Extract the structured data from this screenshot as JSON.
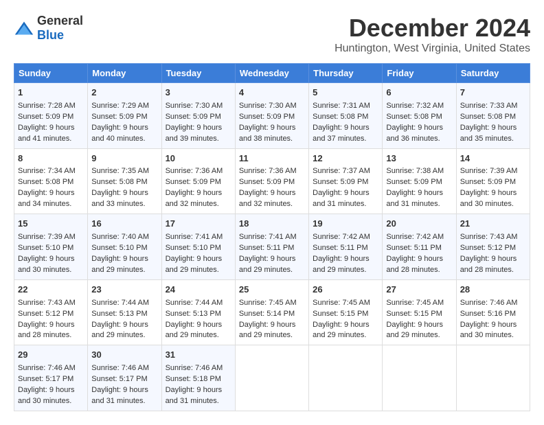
{
  "logo": {
    "general": "General",
    "blue": "Blue"
  },
  "title": "December 2024",
  "subtitle": "Huntington, West Virginia, United States",
  "days_of_week": [
    "Sunday",
    "Monday",
    "Tuesday",
    "Wednesday",
    "Thursday",
    "Friday",
    "Saturday"
  ],
  "weeks": [
    [
      {
        "day": "1",
        "sunrise": "Sunrise: 7:28 AM",
        "sunset": "Sunset: 5:09 PM",
        "daylight": "Daylight: 9 hours and 41 minutes."
      },
      {
        "day": "2",
        "sunrise": "Sunrise: 7:29 AM",
        "sunset": "Sunset: 5:09 PM",
        "daylight": "Daylight: 9 hours and 40 minutes."
      },
      {
        "day": "3",
        "sunrise": "Sunrise: 7:30 AM",
        "sunset": "Sunset: 5:09 PM",
        "daylight": "Daylight: 9 hours and 39 minutes."
      },
      {
        "day": "4",
        "sunrise": "Sunrise: 7:30 AM",
        "sunset": "Sunset: 5:09 PM",
        "daylight": "Daylight: 9 hours and 38 minutes."
      },
      {
        "day": "5",
        "sunrise": "Sunrise: 7:31 AM",
        "sunset": "Sunset: 5:08 PM",
        "daylight": "Daylight: 9 hours and 37 minutes."
      },
      {
        "day": "6",
        "sunrise": "Sunrise: 7:32 AM",
        "sunset": "Sunset: 5:08 PM",
        "daylight": "Daylight: 9 hours and 36 minutes."
      },
      {
        "day": "7",
        "sunrise": "Sunrise: 7:33 AM",
        "sunset": "Sunset: 5:08 PM",
        "daylight": "Daylight: 9 hours and 35 minutes."
      }
    ],
    [
      {
        "day": "8",
        "sunrise": "Sunrise: 7:34 AM",
        "sunset": "Sunset: 5:08 PM",
        "daylight": "Daylight: 9 hours and 34 minutes."
      },
      {
        "day": "9",
        "sunrise": "Sunrise: 7:35 AM",
        "sunset": "Sunset: 5:08 PM",
        "daylight": "Daylight: 9 hours and 33 minutes."
      },
      {
        "day": "10",
        "sunrise": "Sunrise: 7:36 AM",
        "sunset": "Sunset: 5:09 PM",
        "daylight": "Daylight: 9 hours and 32 minutes."
      },
      {
        "day": "11",
        "sunrise": "Sunrise: 7:36 AM",
        "sunset": "Sunset: 5:09 PM",
        "daylight": "Daylight: 9 hours and 32 minutes."
      },
      {
        "day": "12",
        "sunrise": "Sunrise: 7:37 AM",
        "sunset": "Sunset: 5:09 PM",
        "daylight": "Daylight: 9 hours and 31 minutes."
      },
      {
        "day": "13",
        "sunrise": "Sunrise: 7:38 AM",
        "sunset": "Sunset: 5:09 PM",
        "daylight": "Daylight: 9 hours and 31 minutes."
      },
      {
        "day": "14",
        "sunrise": "Sunrise: 7:39 AM",
        "sunset": "Sunset: 5:09 PM",
        "daylight": "Daylight: 9 hours and 30 minutes."
      }
    ],
    [
      {
        "day": "15",
        "sunrise": "Sunrise: 7:39 AM",
        "sunset": "Sunset: 5:10 PM",
        "daylight": "Daylight: 9 hours and 30 minutes."
      },
      {
        "day": "16",
        "sunrise": "Sunrise: 7:40 AM",
        "sunset": "Sunset: 5:10 PM",
        "daylight": "Daylight: 9 hours and 29 minutes."
      },
      {
        "day": "17",
        "sunrise": "Sunrise: 7:41 AM",
        "sunset": "Sunset: 5:10 PM",
        "daylight": "Daylight: 9 hours and 29 minutes."
      },
      {
        "day": "18",
        "sunrise": "Sunrise: 7:41 AM",
        "sunset": "Sunset: 5:11 PM",
        "daylight": "Daylight: 9 hours and 29 minutes."
      },
      {
        "day": "19",
        "sunrise": "Sunrise: 7:42 AM",
        "sunset": "Sunset: 5:11 PM",
        "daylight": "Daylight: 9 hours and 29 minutes."
      },
      {
        "day": "20",
        "sunrise": "Sunrise: 7:42 AM",
        "sunset": "Sunset: 5:11 PM",
        "daylight": "Daylight: 9 hours and 28 minutes."
      },
      {
        "day": "21",
        "sunrise": "Sunrise: 7:43 AM",
        "sunset": "Sunset: 5:12 PM",
        "daylight": "Daylight: 9 hours and 28 minutes."
      }
    ],
    [
      {
        "day": "22",
        "sunrise": "Sunrise: 7:43 AM",
        "sunset": "Sunset: 5:12 PM",
        "daylight": "Daylight: 9 hours and 28 minutes."
      },
      {
        "day": "23",
        "sunrise": "Sunrise: 7:44 AM",
        "sunset": "Sunset: 5:13 PM",
        "daylight": "Daylight: 9 hours and 29 minutes."
      },
      {
        "day": "24",
        "sunrise": "Sunrise: 7:44 AM",
        "sunset": "Sunset: 5:13 PM",
        "daylight": "Daylight: 9 hours and 29 minutes."
      },
      {
        "day": "25",
        "sunrise": "Sunrise: 7:45 AM",
        "sunset": "Sunset: 5:14 PM",
        "daylight": "Daylight: 9 hours and 29 minutes."
      },
      {
        "day": "26",
        "sunrise": "Sunrise: 7:45 AM",
        "sunset": "Sunset: 5:15 PM",
        "daylight": "Daylight: 9 hours and 29 minutes."
      },
      {
        "day": "27",
        "sunrise": "Sunrise: 7:45 AM",
        "sunset": "Sunset: 5:15 PM",
        "daylight": "Daylight: 9 hours and 29 minutes."
      },
      {
        "day": "28",
        "sunrise": "Sunrise: 7:46 AM",
        "sunset": "Sunset: 5:16 PM",
        "daylight": "Daylight: 9 hours and 30 minutes."
      }
    ],
    [
      {
        "day": "29",
        "sunrise": "Sunrise: 7:46 AM",
        "sunset": "Sunset: 5:17 PM",
        "daylight": "Daylight: 9 hours and 30 minutes."
      },
      {
        "day": "30",
        "sunrise": "Sunrise: 7:46 AM",
        "sunset": "Sunset: 5:17 PM",
        "daylight": "Daylight: 9 hours and 31 minutes."
      },
      {
        "day": "31",
        "sunrise": "Sunrise: 7:46 AM",
        "sunset": "Sunset: 5:18 PM",
        "daylight": "Daylight: 9 hours and 31 minutes."
      },
      null,
      null,
      null,
      null
    ]
  ]
}
